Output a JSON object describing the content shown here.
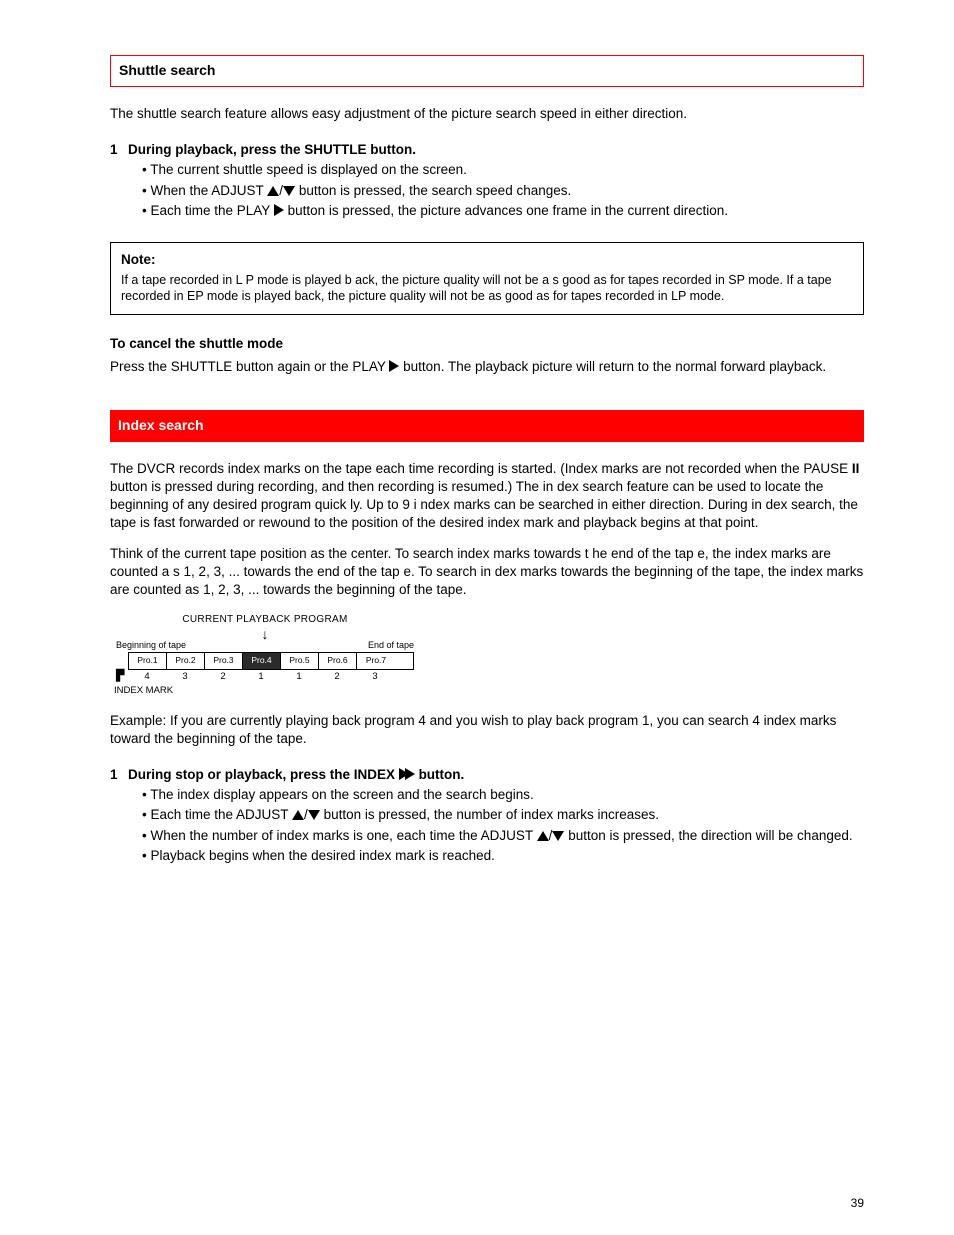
{
  "section1": {
    "title": "Shuttle search",
    "intro": "The shuttle search feature allows easy adjustment of the picture search speed in either direction.",
    "step1": {
      "title": "During playback, press the SHUTTLE button.",
      "line1": "The current shuttle speed is displayed on the screen.",
      "line2a": "When the ADJUST ",
      "line2b": "/",
      "line2c": " button is pressed, the search speed changes.",
      "line3a": "Each time the PLAY ",
      "line3b": " button is pressed, the picture advances one frame in the current direction."
    },
    "note": {
      "title": "Note:",
      "body": "If a tape recorded in L P mode is played b ack, the picture quality will not be a s good as for tapes recorded in SP mode. If a tape recorded in EP mode is played back, the picture quality will not be as good as for tapes recorded in LP mode."
    },
    "cancel_title": "To cancel the shuttle mode",
    "cancel_pre": "Press the SHUTTLE button again or the PLAY ",
    "cancel_post": " button. The playback picture will return to the normal forward playback."
  },
  "section2": {
    "title": "Index search",
    "intro1_pre": "The DVCR records index marks on the tape each time recording is started. (Index marks are not recorded when the PAUSE ",
    "intro1_post": " button is pressed during recording, and then recording is resumed.) The in dex search feature can be used to locate the beginning of any desired program quick ly. Up to 9 i ndex marks can be searched in either direction. During in dex search, the tape is fast forwarded or rewound to the position of the desired index mark and playback begins at that point.",
    "intro2": "Think of the current tape position as the center. To search index marks towards t he end of the tap e, the index marks are counted a s 1, 2, 3, ... towards the end of the tap e. To search in dex marks towards the beginning of the tape, the index marks are counted as 1, 2, 3, ... towards the beginning of the tape.",
    "diagram": {
      "title": "CURRENT PLAYBACK PROGRAM",
      "left_label": "Beginning of tape",
      "right_label": "End of tape",
      "cells": [
        "Pro.1",
        "Pro.2",
        "Pro.3",
        "Pro.4",
        "Pro.5",
        "Pro.6",
        "Pro.7"
      ],
      "nums": [
        "4",
        "3",
        "2",
        "1",
        "1",
        "2",
        "3"
      ],
      "index_label": "INDEX MARK"
    },
    "example": "Example: If you are currently playing back program 4 and you wish to play back program 1, you can search 4 index marks toward the beginning of the tape.",
    "step1": {
      "title_pre": "During stop or playback, press the INDEX ",
      "title_post": " button.",
      "line1": "The index display appears on the screen and the search begins.",
      "line2a": "Each time the ADJUST ",
      "line2b": "/",
      "line2c": " button is pressed, the number of index marks increases.",
      "line3a_pre": "When the number of index marks is one, each time the ADJUST ",
      "line3a_post": " button is pressed, the direction will be changed.",
      "line4": "Playback begins when the desired index mark is reached."
    }
  },
  "page_number": "39"
}
